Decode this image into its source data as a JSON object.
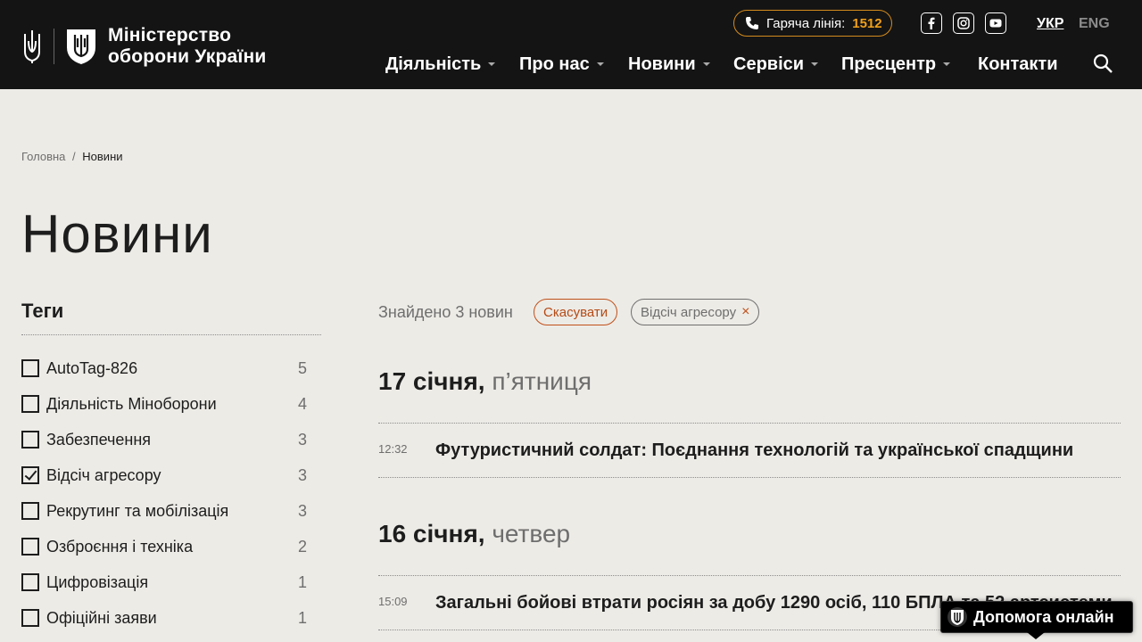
{
  "header": {
    "logo_line1": "Міністерство",
    "logo_line2": "оборони України",
    "hotline_label": "Гаряча лінія:",
    "hotline_number": "1512",
    "social": [
      "facebook-icon",
      "instagram-icon",
      "youtube-icon"
    ],
    "lang_active": "УКР",
    "lang_other": "ENG",
    "nav": [
      "Діяльність",
      "Про нас",
      "Новини",
      "Сервіси",
      "Пресцентр",
      "Контакти"
    ]
  },
  "breadcrumb": {
    "home": "Головна",
    "separator": "/",
    "current": "Новини"
  },
  "page_title": "Новини",
  "tags": {
    "heading": "Теги",
    "items": [
      {
        "label": "AutoTag-826",
        "count": "5",
        "checked": false
      },
      {
        "label": "Діяльність Міноборони",
        "count": "4",
        "checked": false
      },
      {
        "label": "Забезпечення",
        "count": "3",
        "checked": false
      },
      {
        "label": "Відсіч агресору",
        "count": "3",
        "checked": true
      },
      {
        "label": "Рекрутинг та мобілізація",
        "count": "3",
        "checked": false
      },
      {
        "label": "Озброєння і техніка",
        "count": "2",
        "checked": false
      },
      {
        "label": "Цифровізація",
        "count": "1",
        "checked": false
      },
      {
        "label": "Офіційні заяви",
        "count": "1",
        "checked": false
      }
    ]
  },
  "results": {
    "found_text": "Знайдено 3 новин",
    "cancel_label": "Скасувати",
    "active_filter": "Відсіч агресору",
    "remove_symbol": "×"
  },
  "news_groups": [
    {
      "date": "17 січня,",
      "weekday": "п’ятниця",
      "items": [
        {
          "time": "12:32",
          "title": "Футуристичний солдат: Поєднання технологій та української спадщини"
        }
      ]
    },
    {
      "date": "16 січня,",
      "weekday": "четвер",
      "items": [
        {
          "time": "15:09",
          "title": "Загальні бойові втрати росіян за добу 1290 осіб, 110 БПЛА та 52 артсистеми"
        }
      ]
    }
  ],
  "help": {
    "label": "Допомога онлайн"
  },
  "colors": {
    "header_bg": "#141414",
    "page_bg": "#edebe6",
    "accent_orange": "#f0a019",
    "cancel_red": "#c0501a"
  }
}
